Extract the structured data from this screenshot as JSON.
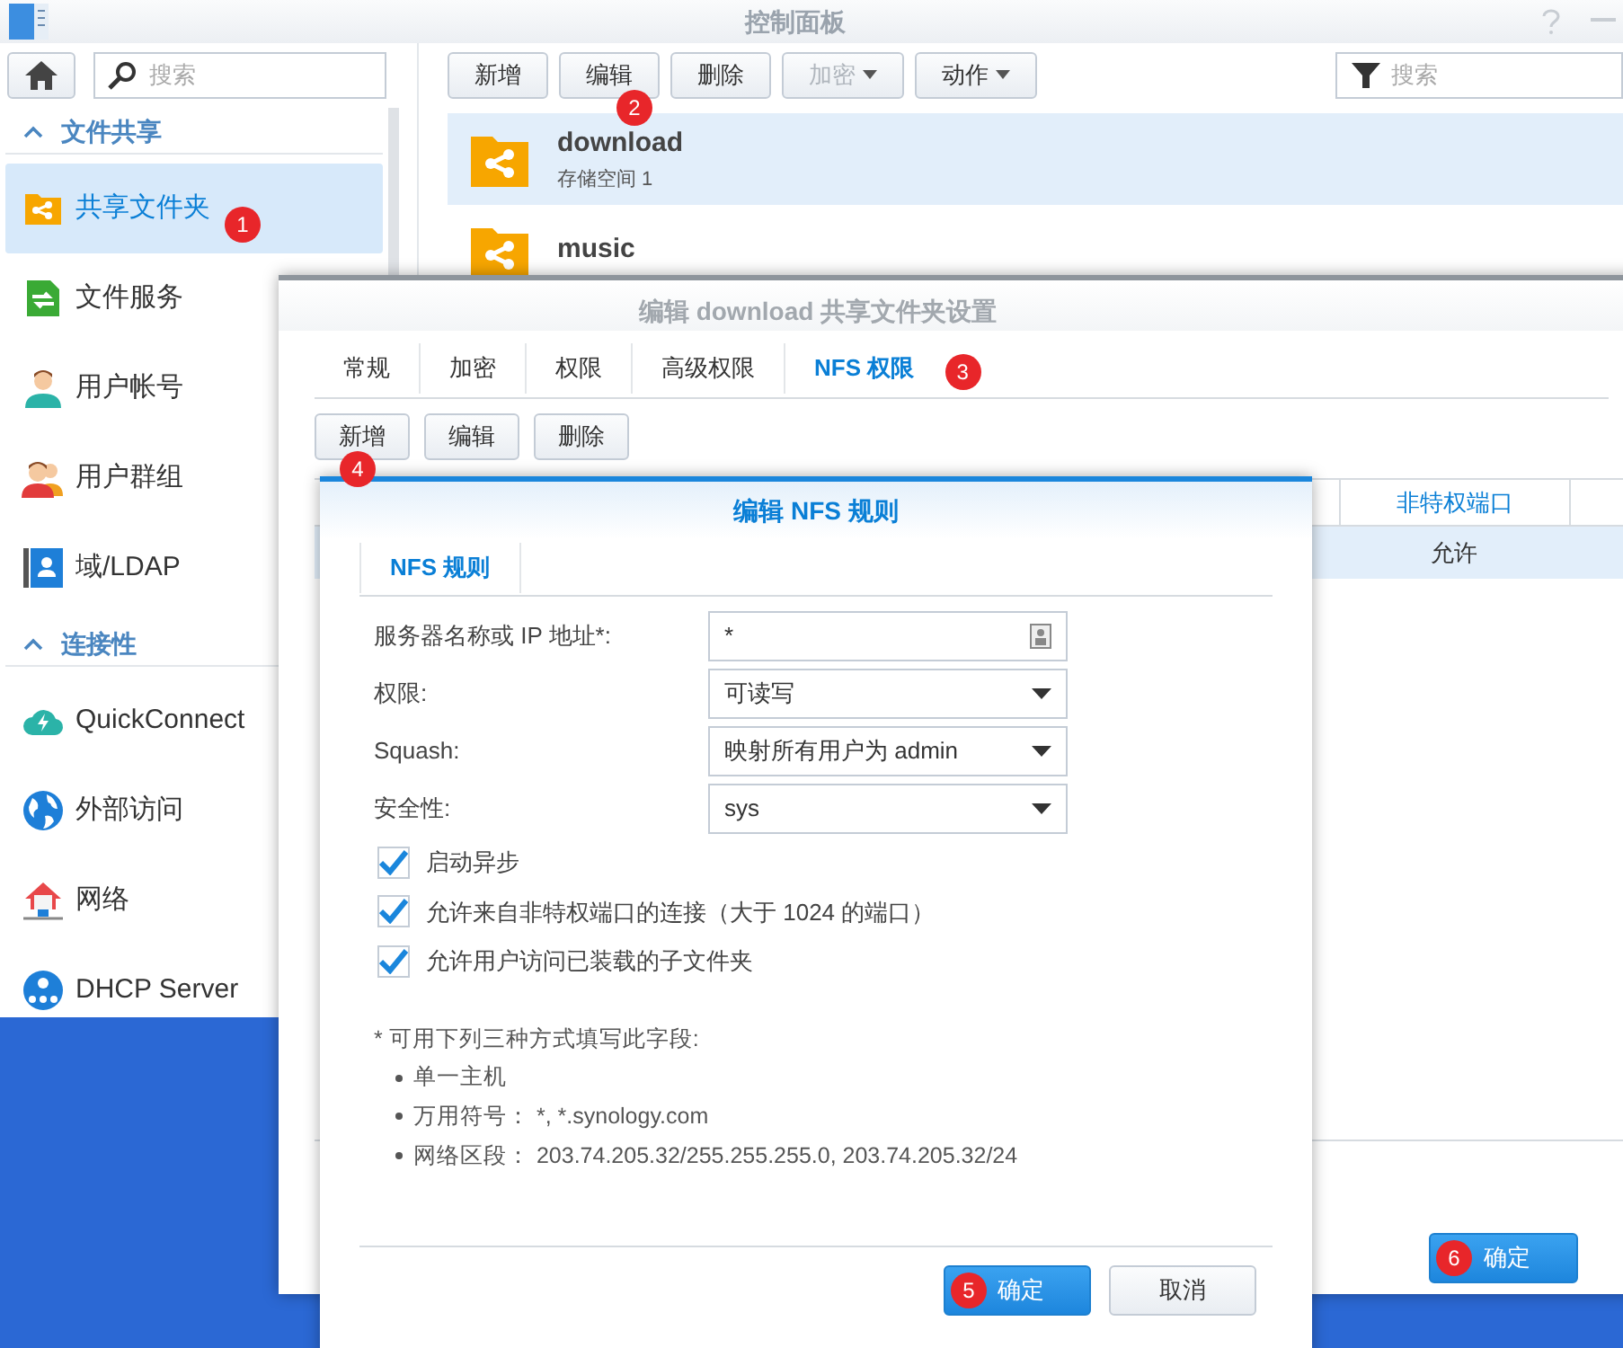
{
  "control_panel": {
    "title": "控制面板",
    "search": {
      "placeholder": "搜索"
    },
    "sidebar": {
      "sections": [
        {
          "label": "文件共享",
          "expanded": true,
          "items": [
            {
              "label": "共享文件夹",
              "selected": true,
              "badge": "1"
            },
            {
              "label": "文件服务",
              "selected": false
            },
            {
              "label": "用户帐号",
              "selected": false
            },
            {
              "label": "用户群组",
              "selected": false
            },
            {
              "label": "域/LDAP",
              "selected": false
            }
          ]
        },
        {
          "label": "连接性",
          "expanded": true,
          "items": [
            {
              "label": "QuickConnect",
              "selected": false
            },
            {
              "label": "外部访问",
              "selected": false
            },
            {
              "label": "网络",
              "selected": false
            },
            {
              "label": "DHCP Server",
              "selected": false
            }
          ]
        }
      ]
    },
    "toolbar": [
      {
        "label": "新增",
        "disabled": false,
        "dropdown": false
      },
      {
        "label": "编辑",
        "disabled": false,
        "dropdown": false,
        "badge": "2"
      },
      {
        "label": "删除",
        "disabled": false,
        "dropdown": false
      },
      {
        "label": "加密",
        "disabled": true,
        "dropdown": true
      },
      {
        "label": "动作",
        "disabled": false,
        "dropdown": true
      }
    ],
    "filter": {
      "placeholder": "搜索"
    },
    "folders": [
      {
        "name": "download",
        "subtitle": "存储空间 1",
        "selected": true
      },
      {
        "name": "music",
        "selected": false
      }
    ]
  },
  "share_dialog": {
    "title": "编辑 download 共享文件夹设置",
    "tabs": [
      {
        "label": "常规",
        "selected": false
      },
      {
        "label": "加密",
        "selected": false
      },
      {
        "label": "权限",
        "selected": false
      },
      {
        "label": "高级权限",
        "selected": false
      },
      {
        "label": "NFS 权限",
        "selected": true,
        "badge": "3"
      }
    ],
    "buttons": [
      {
        "label": "新增",
        "badge": "4"
      },
      {
        "label": "编辑"
      },
      {
        "label": "删除"
      }
    ],
    "table": {
      "columns": [
        "非特权端口"
      ],
      "rows": [
        {
          "cells": [
            "允许"
          ],
          "selected": true
        }
      ]
    },
    "ok_button": {
      "label": "确定",
      "badge": "6"
    }
  },
  "nfs_dialog": {
    "title": "编辑 NFS 规则",
    "tabs": [
      {
        "label": "NFS 规则",
        "selected": true
      }
    ],
    "fields": [
      {
        "kind": "text",
        "label": "服务器名称或 IP 地址*:",
        "value": "*"
      },
      {
        "kind": "select",
        "label": "权限:",
        "value": "可读写"
      },
      {
        "kind": "select",
        "label": "Squash:",
        "value": "映射所有用户为 admin"
      },
      {
        "kind": "select",
        "label": "安全性:",
        "value": "sys"
      }
    ],
    "checkboxes": [
      {
        "label": "启动异步",
        "checked": true
      },
      {
        "label": "允许来自非特权端口的连接（大于 1024 的端口）",
        "checked": true
      },
      {
        "label": "允许用户访问已装载的子文件夹",
        "checked": true
      }
    ],
    "note": {
      "heading": "* 可用下列三种方式填写此字段:",
      "bullets": [
        "单一主机",
        "万用符号： *, *.synology.com",
        "网络区段： 203.74.205.32/255.255.255.0, 203.74.205.32/24"
      ]
    },
    "buttons": [
      {
        "label": "确定",
        "primary": true,
        "badge": "5"
      },
      {
        "label": "取消",
        "primary": false
      }
    ]
  }
}
